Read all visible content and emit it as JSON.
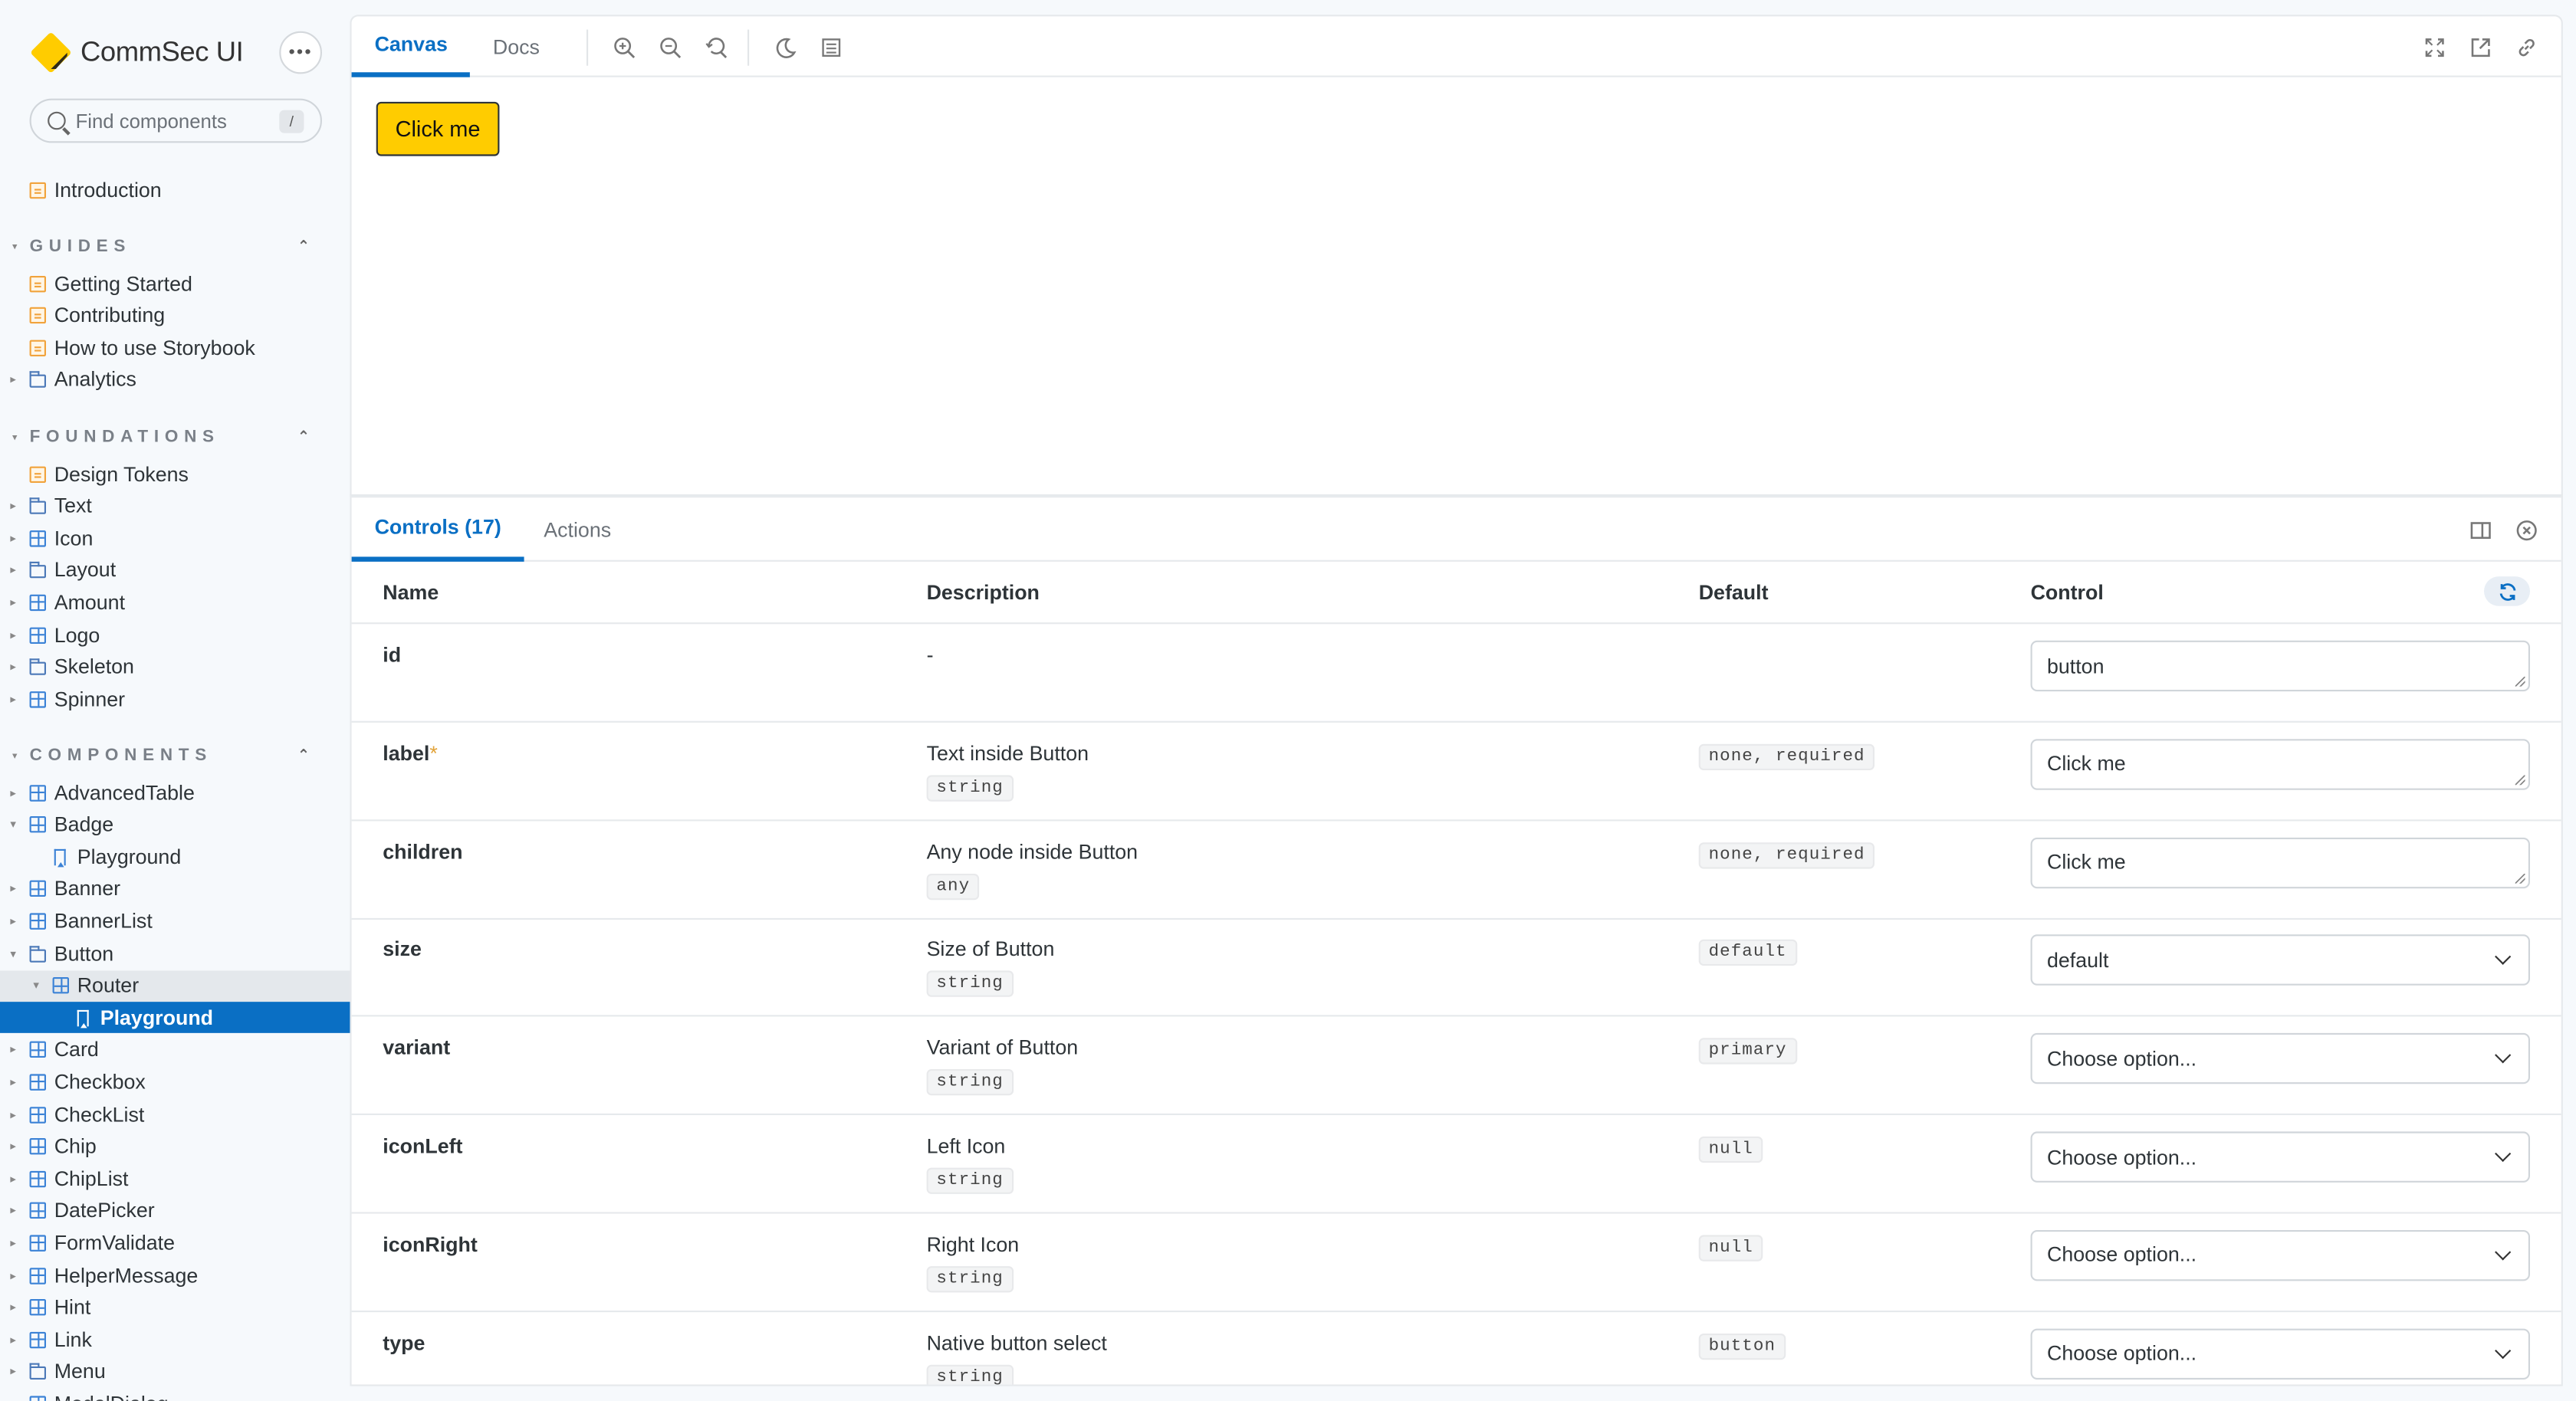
{
  "app": {
    "brand": "CommSec UI",
    "search_placeholder": "Find components",
    "search_shortcut": "/"
  },
  "sidebar": {
    "top_items": [
      {
        "label": "Introduction",
        "icon": "doc-icon"
      }
    ],
    "sections": [
      {
        "title": "GUIDES",
        "items": [
          {
            "label": "Getting Started",
            "icon": "doc-icon"
          },
          {
            "label": "Contributing",
            "icon": "doc-icon"
          },
          {
            "label": "How to use Storybook",
            "icon": "doc-icon"
          },
          {
            "label": "Analytics",
            "icon": "folder-icon"
          }
        ]
      },
      {
        "title": "FOUNDATIONS",
        "items": [
          {
            "label": "Design Tokens",
            "icon": "doc-icon"
          },
          {
            "label": "Text",
            "icon": "folder-icon"
          },
          {
            "label": "Icon",
            "icon": "component-icon"
          },
          {
            "label": "Layout",
            "icon": "folder-icon"
          },
          {
            "label": "Amount",
            "icon": "component-icon"
          },
          {
            "label": "Logo",
            "icon": "component-icon"
          },
          {
            "label": "Skeleton",
            "icon": "folder-icon"
          },
          {
            "label": "Spinner",
            "icon": "component-icon"
          }
        ]
      },
      {
        "title": "COMPONENTS",
        "items": [
          {
            "label": "AdvancedTable",
            "icon": "component-icon"
          },
          {
            "label": "Badge",
            "icon": "component-icon",
            "expanded": true
          },
          {
            "label": "Playground",
            "icon": "story-icon",
            "depth": 1
          },
          {
            "label": "Banner",
            "icon": "component-icon"
          },
          {
            "label": "BannerList",
            "icon": "component-icon"
          },
          {
            "label": "Button",
            "icon": "folder-icon",
            "expanded": true
          },
          {
            "label": "Router",
            "icon": "component-icon",
            "depth": 1,
            "expanded": true
          },
          {
            "label": "Playground",
            "icon": "story-icon",
            "depth": 2,
            "active": true
          },
          {
            "label": "Card",
            "icon": "component-icon"
          },
          {
            "label": "Checkbox",
            "icon": "component-icon"
          },
          {
            "label": "CheckList",
            "icon": "component-icon"
          },
          {
            "label": "Chip",
            "icon": "component-icon"
          },
          {
            "label": "ChipList",
            "icon": "component-icon"
          },
          {
            "label": "DatePicker",
            "icon": "component-icon"
          },
          {
            "label": "FormValidate",
            "icon": "component-icon"
          },
          {
            "label": "HelperMessage",
            "icon": "component-icon"
          },
          {
            "label": "Hint",
            "icon": "component-icon"
          },
          {
            "label": "Link",
            "icon": "component-icon"
          },
          {
            "label": "Menu",
            "icon": "folder-icon"
          },
          {
            "label": "ModalDialog",
            "icon": "component-icon"
          }
        ]
      }
    ]
  },
  "preview": {
    "tabs": [
      "Canvas",
      "Docs"
    ],
    "active_tab": "Canvas",
    "canvas_button_label": "Click me"
  },
  "panel": {
    "tabs": [
      "Controls (17)",
      "Actions"
    ],
    "active_tab": "Controls (17)",
    "columns": [
      "Name",
      "Description",
      "Default",
      "Control"
    ],
    "rows": [
      {
        "name": "id",
        "required": false,
        "description": "-",
        "type": "",
        "default": "",
        "control": "text",
        "value": "button"
      },
      {
        "name": "label",
        "required": true,
        "description": "Text inside Button",
        "type": "string",
        "default": "none, required",
        "control": "text",
        "value": "Click me"
      },
      {
        "name": "children",
        "required": false,
        "description": "Any node inside Button",
        "type": "any",
        "default": "none, required",
        "control": "text",
        "value": "Click me"
      },
      {
        "name": "size",
        "required": false,
        "description": "Size of Button",
        "type": "string",
        "default": "default",
        "control": "select",
        "value": "default"
      },
      {
        "name": "variant",
        "required": false,
        "description": "Variant of Button",
        "type": "string",
        "default": "primary",
        "control": "select",
        "value": "Choose option..."
      },
      {
        "name": "iconLeft",
        "required": false,
        "description": "Left Icon",
        "type": "string",
        "default": "null",
        "control": "select",
        "value": "Choose option..."
      },
      {
        "name": "iconRight",
        "required": false,
        "description": "Right Icon",
        "type": "string",
        "default": "null",
        "control": "select",
        "value": "Choose option..."
      },
      {
        "name": "type",
        "required": false,
        "description": "Native button select",
        "type": "string",
        "default": "button",
        "control": "select",
        "value": "Choose option..."
      }
    ]
  },
  "colors": {
    "accent": "#0a6fc4",
    "brand_yellow": "#ffcc00"
  }
}
